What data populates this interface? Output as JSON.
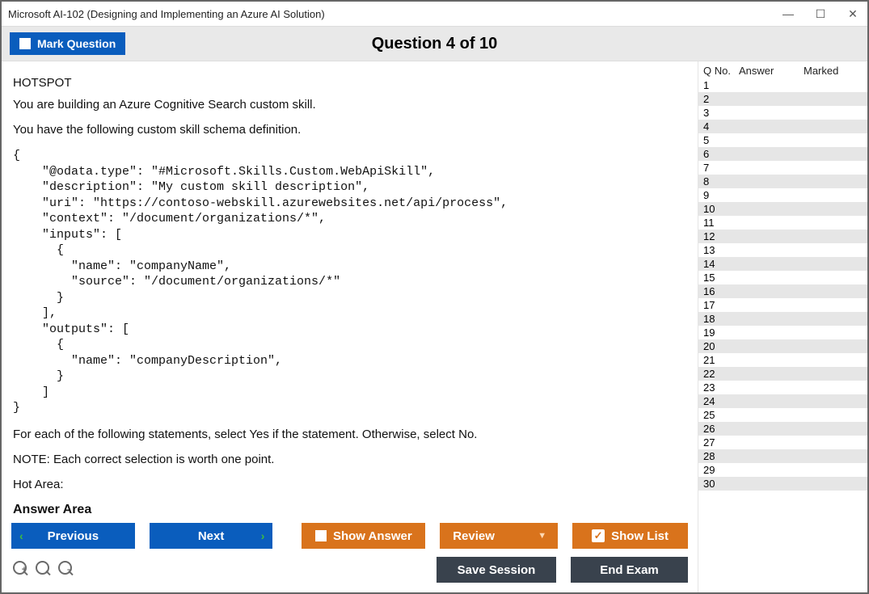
{
  "window": {
    "title": "Microsoft AI-102 (Designing and Implementing an Azure AI Solution)"
  },
  "toolbar": {
    "mark_label": "Mark Question",
    "question_title": "Question 4 of 10"
  },
  "question": {
    "type": "HOTSPOT",
    "intro1": "You are building an Azure Cognitive Search custom skill.",
    "intro2": "You have the following custom skill schema definition.",
    "code": "{\n    \"@odata.type\": \"#Microsoft.Skills.Custom.WebApiSkill\",\n    \"description\": \"My custom skill description\",\n    \"uri\": \"https://contoso-webskill.azurewebsites.net/api/process\",\n    \"context\": \"/document/organizations/*\",\n    \"inputs\": [\n      {\n        \"name\": \"companyName\",\n        \"source\": \"/document/organizations/*\"\n      }\n    ],\n    \"outputs\": [\n      {\n        \"name\": \"companyDescription\",\n      }\n    ]\n}",
    "instr1": "For each of the following statements, select Yes if the statement. Otherwise, select No.",
    "instr2": "NOTE: Each correct selection is worth one point.",
    "hotarea": "Hot Area:",
    "answer_area": "Answer Area"
  },
  "sidepanel": {
    "headers": {
      "qno": "Q No.",
      "answer": "Answer",
      "marked": "Marked"
    },
    "rows": [
      1,
      2,
      3,
      4,
      5,
      6,
      7,
      8,
      9,
      10,
      11,
      12,
      13,
      14,
      15,
      16,
      17,
      18,
      19,
      20,
      21,
      22,
      23,
      24,
      25,
      26,
      27,
      28,
      29,
      30
    ]
  },
  "footer": {
    "previous": "Previous",
    "next": "Next",
    "show_answer": "Show Answer",
    "review": "Review",
    "show_list": "Show List",
    "save_session": "Save Session",
    "end_exam": "End Exam"
  }
}
